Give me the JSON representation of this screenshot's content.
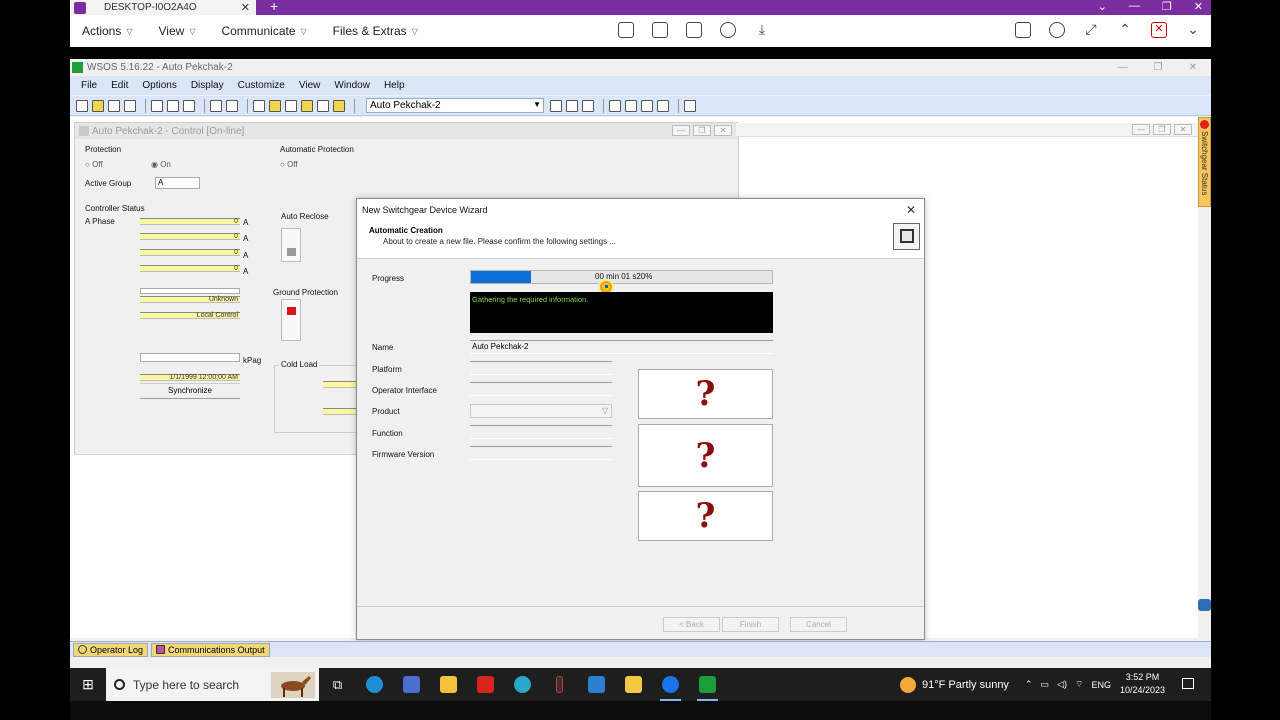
{
  "remote_desktop": {
    "tab_title": "DESKTOP-I0O2A4O",
    "menus": [
      "Actions",
      "View",
      "Communicate",
      "Files & Extras"
    ]
  },
  "wsos": {
    "title": "WSOS 5.16.22 - Auto Pekchak-2",
    "menu": [
      "File",
      "Edit",
      "Options",
      "Display",
      "Customize",
      "View",
      "Window",
      "Help"
    ],
    "device_combo": "Auto Pekchak-2"
  },
  "control_window": {
    "title": "Auto Pekchak-2 - Control [On-line]",
    "protection_label": "Protection",
    "off_label": "Off",
    "on_label": "On",
    "active_group_label": "Active Group",
    "active_group_value": "A",
    "controller_status_label": "Controller Status",
    "a_phase_label": "A Phase",
    "unit_a": "A",
    "phase_values": [
      "0",
      "0",
      "0",
      "0"
    ],
    "unknown_value": "Unknown",
    "local_control_value": "Local Control",
    "kpag_label": "kPag",
    "date_value": "1/1/1999 12:00:00 AM",
    "synchronize_button": "Synchronize",
    "automatic_protection_label": "Automatic Protection",
    "auto_reclose_label": "Auto Reclose",
    "ground_protection_label": "Ground Protection",
    "cold_load_label": "Cold Load"
  },
  "side_tab": "Switchgear Status",
  "wizard": {
    "title": "New Switchgear Device Wizard",
    "header_title": "Automatic Creation",
    "header_subtitle": "About to create a new file. Please confirm the following settings ...",
    "progress_label": "Progress",
    "progress_text": "00 min 01 s",
    "progress_percent_text": "20%",
    "progress_fraction": 0.2,
    "log_text": "Gathering the required information.",
    "fields": {
      "name_label": "Name",
      "name_value": "Auto Pekchak-2",
      "platform_label": "Platform",
      "operator_interface_label": "Operator Interface",
      "product_label": "Product",
      "function_label": "Function",
      "firmware_version_label": "Firmware Version"
    },
    "question_mark": "?",
    "buttons": {
      "back": "< Back",
      "finish": "Finish",
      "cancel": "Cancel"
    }
  },
  "bottom_tabs": [
    "Operator Log",
    "Communications Output"
  ],
  "taskbar": {
    "search_placeholder": "Type here to search",
    "weather": "91°F  Partly sunny",
    "lang": "ENG",
    "time": "3:52 PM",
    "date": "10/24/2023"
  },
  "colors": {
    "accent_purple": "#7b2e9f",
    "progress_blue": "#0a6fd8",
    "question_red": "#8b0d0d",
    "yellow_field": "#fbf7a0"
  }
}
